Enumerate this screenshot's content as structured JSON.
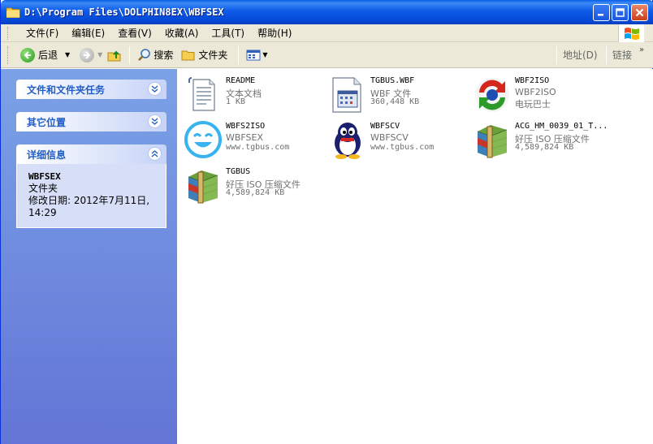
{
  "window": {
    "title": "D:\\Program Files\\DOLPHIN8EX\\WBFSEX"
  },
  "menu": [
    {
      "key": "file",
      "label": "文件(F)"
    },
    {
      "key": "edit",
      "label": "编辑(E)"
    },
    {
      "key": "view",
      "label": "查看(V)"
    },
    {
      "key": "favorites",
      "label": "收藏(A)"
    },
    {
      "key": "tools",
      "label": "工具(T)"
    },
    {
      "key": "help",
      "label": "帮助(H)"
    }
  ],
  "toolbar": {
    "back": "后退",
    "search": "搜索",
    "folders": "文件夹",
    "address": "地址(D)",
    "links": "链接"
  },
  "sidebar": {
    "tasks": {
      "title": "文件和文件夹任务"
    },
    "other": {
      "title": "其它位置"
    },
    "details": {
      "title": "详细信息",
      "name": "WBFSEX",
      "type": "文件夹",
      "modified": "修改日期: 2012年7月11日,",
      "time": "14:29"
    }
  },
  "files": [
    {
      "name": "README",
      "line2": "文本文档",
      "line3": "1 KB",
      "icon": "text-document-icon"
    },
    {
      "name": "TGBUS.WBF",
      "line2": "WBF 文件",
      "line3": "360,448 KB",
      "icon": "wbf-file-icon"
    },
    {
      "name": "WBF2ISO",
      "line2": "WBF2ISO",
      "line3": "电玩巴士",
      "icon": "wbf2iso-app-icon"
    },
    {
      "name": "WBFS2ISO",
      "line2": "WBFSEX",
      "line3": "www.tgbus.com",
      "icon": "smiley-app-icon"
    },
    {
      "name": "WBFSCV",
      "line2": "WBFSCV",
      "line3": "www.tgbus.com",
      "icon": "penguin-app-icon"
    },
    {
      "name": "ACG_HM_0039_01_T...",
      "line2": "好压 ISO 压缩文件",
      "line3": "4,589,824 KB",
      "icon": "archive-icon"
    },
    {
      "name": "TGBUS",
      "line2": "好压 ISO 压缩文件",
      "line3": "4,589,824 KB",
      "icon": "archive-icon"
    }
  ],
  "colors": {
    "titlebar": "#0a5ee6",
    "sidebar": "#7ba2e7",
    "panel_title": "#215dc6",
    "toolbar": "#ece9d8"
  }
}
